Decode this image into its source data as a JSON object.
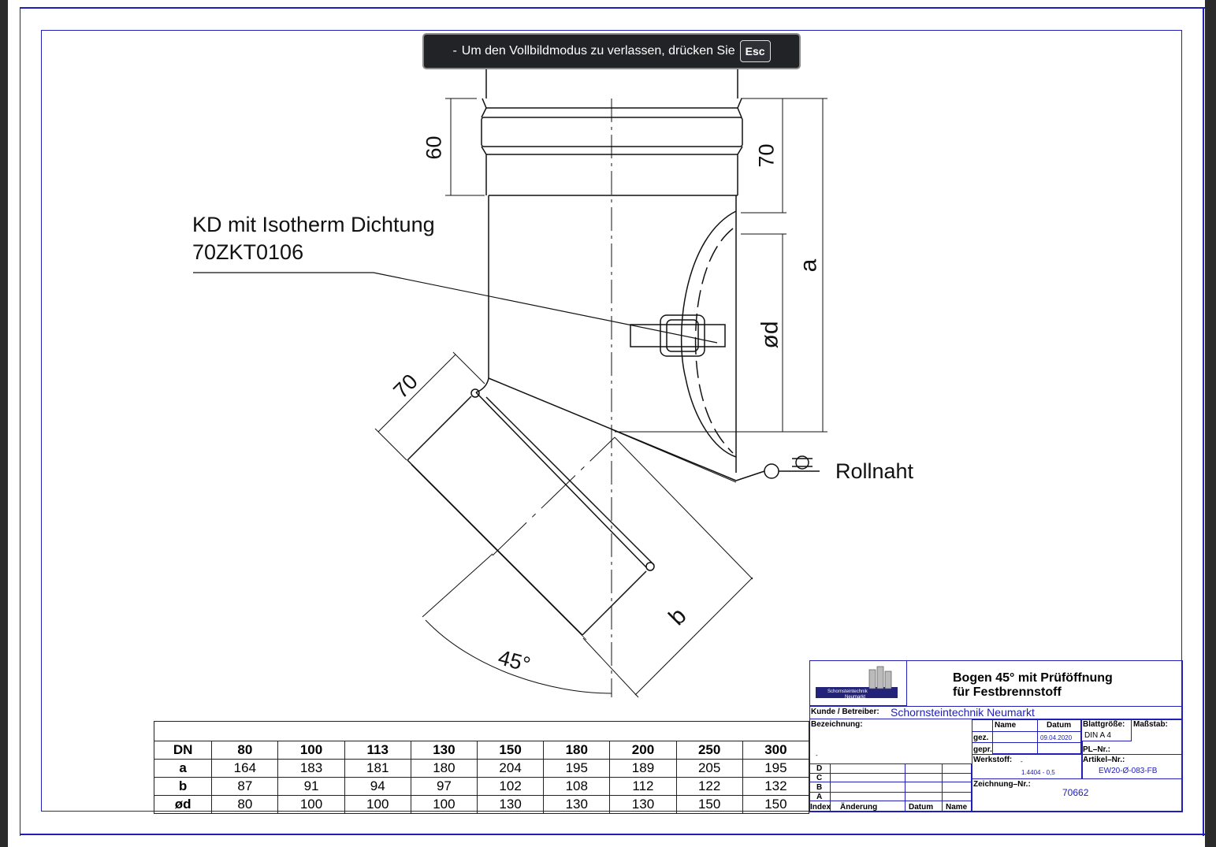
{
  "fullscreen_notice": {
    "dash": "-",
    "text": "Um den Vollbildmodus zu verlassen, drücken Sie",
    "key": "Esc"
  },
  "drawing": {
    "callout_line1": "KD mit Isotherm Dichtung",
    "callout_line2": "70ZKT0106",
    "rollnaht": "Rollnaht",
    "dim_60": "60",
    "dim_70_top": "70",
    "dim_a": "a",
    "dim_od": "ød",
    "dim_70_branch": "70",
    "dim_b": "b",
    "angle": "45°"
  },
  "dimension_table": {
    "header": [
      "DN",
      "80",
      "100",
      "113",
      "130",
      "150",
      "180",
      "200",
      "250",
      "300"
    ],
    "rows": [
      [
        "a",
        "164",
        "183",
        "181",
        "180",
        "204",
        "195",
        "189",
        "205",
        "195"
      ],
      [
        "b",
        "87",
        "91",
        "94",
        "97",
        "102",
        "108",
        "112",
        "122",
        "132"
      ],
      [
        "ød",
        "80",
        "100",
        "100",
        "100",
        "130",
        "130",
        "130",
        "150",
        "150"
      ]
    ]
  },
  "title_block": {
    "logo_text_line1": "Schornsteintechnik",
    "logo_text_line2": "Neumarkt",
    "title_line1": "Bogen 45° mit Prüföffnung",
    "title_line2": "für Festbrennstoff",
    "kunde_label": "Kunde / Betreiber:",
    "kunde_value": "Schornsteintechnik Neumarkt",
    "bezeichnung_label": "Bezeichnung:",
    "bezeichnung_value": "-",
    "name_header": "Name",
    "datum_header": "Datum",
    "blattgroesse_label": "Blattgröße:",
    "massstab_label": "Maßstab:",
    "gez_label": "gez.",
    "gez_date": "09.04.2020",
    "blattgroesse_value": "DIN A 4",
    "gepr_label": "gepr.",
    "pl_label": "PL–Nr.:",
    "werkstoff_label": "Werkstoff:",
    "werkstoff_dash": "-",
    "werkstoff_value": "1.4404 - 0,5",
    "artikel_label": "Artikel–Nr.:",
    "artikel_value": "EW20-Ø-083-FB",
    "zeichnung_label": "Zeichnung–Nr.:",
    "zeichnung_value": "70662",
    "rev_letters": [
      "D",
      "C",
      "B",
      "A"
    ],
    "index_label": "Index",
    "aenderung_label": "Änderung",
    "rev_datum_label": "Datum",
    "rev_name_label": "Name"
  }
}
